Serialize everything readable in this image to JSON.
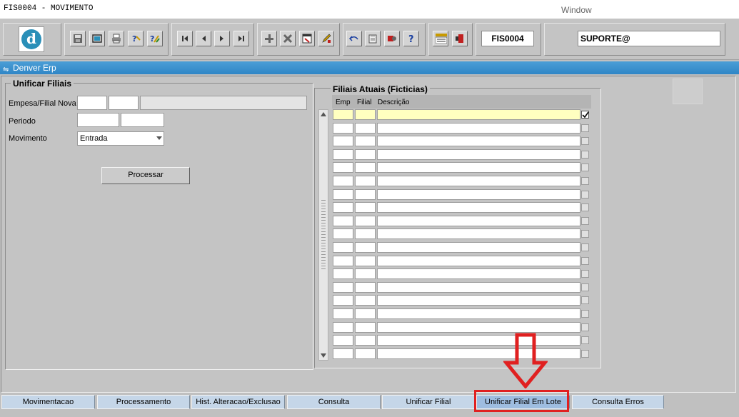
{
  "app": {
    "title": "FIS0004 - MOVIMENTO",
    "window_menu": "Window"
  },
  "toolbar": {
    "logo_letter": "d",
    "form_code": "FIS0004",
    "user": "SUPORTE@"
  },
  "window": {
    "title": "Denver Erp"
  },
  "left_panel": {
    "title": "Unificar Filiais",
    "empresa_label": "Empesa/Filial Nova",
    "periodo_label": "Periodo",
    "movimento_label": "Movimento",
    "movimento_value": "Entrada",
    "processar_label": "Processar"
  },
  "right_panel": {
    "title": "Filiais Atuais (Ficticias)",
    "col_emp": "Emp",
    "col_filial": "Filial",
    "col_descricao": "Descrição",
    "first_row_checked": true,
    "row_count": 19
  },
  "tabs": [
    "Movimentacao",
    "Processamento",
    "Hist. Alteracao/Exclusao",
    "Consulta",
    "Unificar Filial",
    "Unificar Filial Em Lote",
    "Consulta Erros"
  ],
  "active_tab": "Unificar Filial Em Lote",
  "colors": {
    "window_bar": "#2f86c6",
    "current_row": "#ffffc0",
    "annotation": "#e02020",
    "tab": "#c5d6e8"
  }
}
